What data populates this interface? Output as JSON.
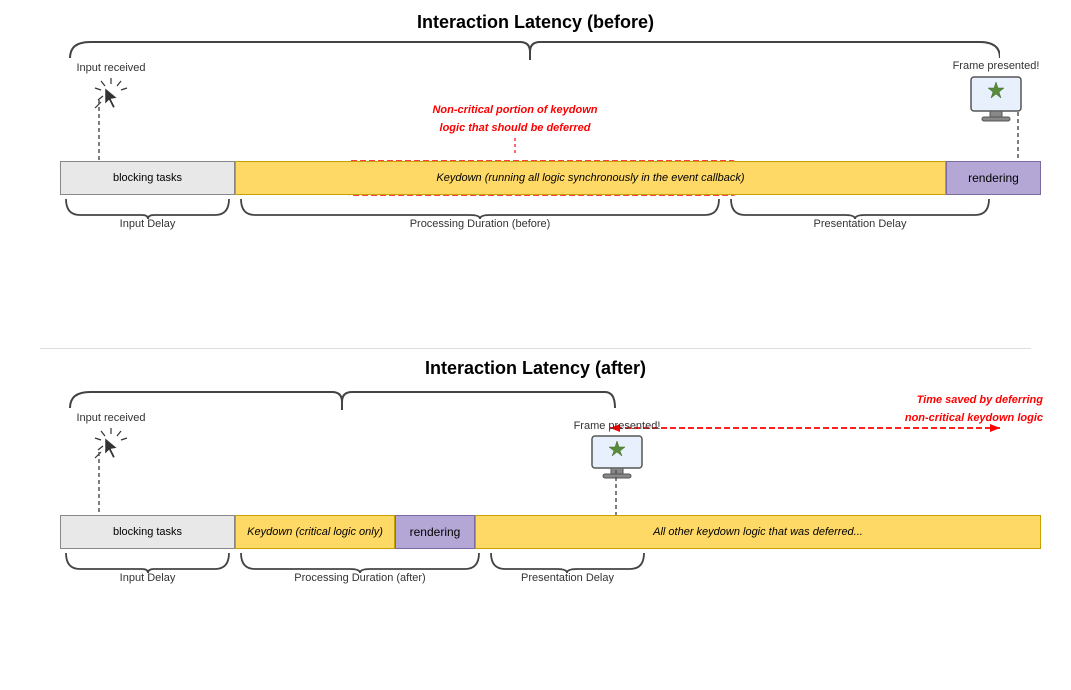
{
  "top_diagram": {
    "title": "Interaction Latency (before)",
    "input_received_label": "Input received",
    "frame_presented_label": "Frame presented!",
    "blocking_tasks_label": "blocking tasks",
    "keydown_label": "Keydown (running all logic synchronously in the event callback)",
    "rendering_label": "rendering",
    "input_delay_label": "Input Delay",
    "processing_duration_label": "Processing Duration (before)",
    "presentation_delay_label": "Presentation Delay",
    "non_critical_label_line1": "Non-critical portion of keydown",
    "non_critical_label_line2": "logic that should be deferred"
  },
  "bottom_diagram": {
    "title": "Interaction Latency (after)",
    "input_received_label": "Input received",
    "frame_presented_label": "Frame presented!",
    "blocking_tasks_label": "blocking tasks",
    "keydown_label": "Keydown (critical logic only)",
    "rendering_label": "rendering",
    "deferred_label": "All other keydown logic that was deferred...",
    "input_delay_label": "Input Delay",
    "processing_duration_label": "Processing Duration (after)",
    "presentation_delay_label": "Presentation Delay",
    "time_saved_line1": "Time saved by deferring",
    "time_saved_line2": "non-critical keydown logic"
  }
}
